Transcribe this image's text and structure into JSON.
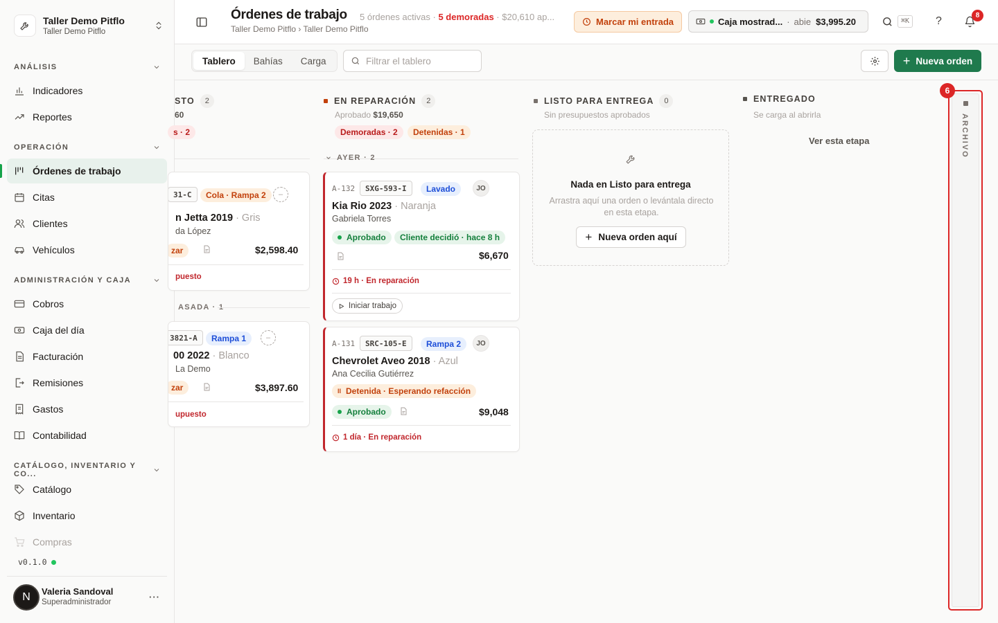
{
  "org": {
    "name": "Taller Demo Pitflo",
    "subtitle": "Taller Demo Pitflo"
  },
  "sidebar": {
    "sections": [
      {
        "label": "ANÁLISIS",
        "items": [
          {
            "label": "Indicadores",
            "icon": "chart-bars-icon"
          },
          {
            "label": "Reportes",
            "icon": "trend-up-icon"
          }
        ]
      },
      {
        "label": "OPERACIÓN",
        "items": [
          {
            "label": "Órdenes de trabajo",
            "icon": "kanban-icon",
            "active": true
          },
          {
            "label": "Citas",
            "icon": "calendar-icon"
          },
          {
            "label": "Clientes",
            "icon": "users-icon"
          },
          {
            "label": "Vehículos",
            "icon": "car-icon"
          }
        ]
      },
      {
        "label": "ADMINISTRACIÓN Y CAJA",
        "items": [
          {
            "label": "Cobros",
            "icon": "credit-card-icon"
          },
          {
            "label": "Caja del día",
            "icon": "cash-register-icon"
          },
          {
            "label": "Facturación",
            "icon": "invoice-icon"
          },
          {
            "label": "Remisiones",
            "icon": "file-export-icon"
          },
          {
            "label": "Gastos",
            "icon": "receipt-icon"
          },
          {
            "label": "Contabilidad",
            "icon": "book-icon"
          }
        ]
      },
      {
        "label": "CATÁLOGO, INVENTARIO Y CO...",
        "items": [
          {
            "label": "Catálogo",
            "icon": "tag-icon"
          },
          {
            "label": "Inventario",
            "icon": "box-icon"
          },
          {
            "label": "Compras",
            "icon": "cart-icon"
          }
        ]
      }
    ],
    "version": "v0.1.0"
  },
  "user": {
    "initial": "N",
    "name": "Valeria Sandoval",
    "role": "Superadministrador"
  },
  "header": {
    "title": "Órdenes de trabajo",
    "summary_active": "5 órdenes activas",
    "summary_sep": " · ",
    "summary_late": "5 demoradas",
    "summary_amount": "$20,610 ap...",
    "breadcrumb": "Taller Demo Pitflo › Taller Demo Pitflo",
    "entry_button": "Marcar mi entrada",
    "cash_label": "Caja mostrad...",
    "cash_status": "abie",
    "cash_amount": "$3,995.20",
    "shortcut": "⌘K",
    "notifications": "8"
  },
  "toolbar": {
    "tabs": [
      "Tablero",
      "Bahías",
      "Carga"
    ],
    "filter_placeholder": "Filtrar el tablero",
    "new_order": "Nueva orden"
  },
  "board": {
    "partial_column": {
      "title_fragment": "STO",
      "count": "2",
      "amount_fragment": "60",
      "badge_fragment": "s · 2",
      "card1": {
        "plate": "31-C",
        "bay": "Cola · Rampa 2",
        "car": "n Jetta 2019",
        "color": "Gris",
        "client": "da López",
        "status": "zar",
        "price": "$2,598.40",
        "footer": "puesto"
      },
      "group": "ASADA · 1",
      "card2": {
        "plate": "3821-A",
        "bay": "Rampa 1",
        "car": "00 2022",
        "color": "Blanco",
        "client": "La Demo",
        "status": "zar",
        "price": "$3,897.60",
        "footer": "upuesto"
      }
    },
    "repair": {
      "title": "EN REPARACIÓN",
      "count": "2",
      "approved_label": "Aprobado",
      "approved_amount": "$19,650",
      "late_badge": "Demoradas · 2",
      "held_badge": "Detenidas · 1",
      "group": "AYER · 2",
      "cards": [
        {
          "id": "A-132",
          "plate": "SXG-593-I",
          "tag": "Lavado",
          "initials": "JO",
          "car": "Kia Rio 2023",
          "color": "Naranja",
          "client": "Gabriela Torres",
          "status": "Aprobado",
          "decision": "Cliente decidió · hace 8 h",
          "price": "$6,670",
          "timer": "19 h · En reparación",
          "action": "Iniciar trabajo"
        },
        {
          "id": "A-131",
          "plate": "SRC-105-E",
          "tag": "Rampa 2",
          "initials": "JO",
          "car": "Chevrolet Aveo 2018",
          "color": "Azul",
          "client": "Ana Cecilia Gutiérrez",
          "hold": "Detenida · Esperando refacción",
          "status": "Aprobado",
          "price": "$9,048",
          "timer": "1 día · En reparación"
        }
      ]
    },
    "ready": {
      "title": "LISTO PARA ENTREGA",
      "count": "0",
      "subtitle": "Sin presupuestos aprobados",
      "empty_title": "Nada en Listo para entrega",
      "empty_desc": "Arrastra aquí una orden o levántala directo en esta etapa.",
      "empty_button": "Nueva orden aquí"
    },
    "delivered": {
      "title": "ENTREGADO",
      "subtitle": "Se carga al abrirla",
      "view_link": "Ver esta etapa"
    },
    "archive": {
      "label": "ARCHIVO",
      "badge": "6"
    }
  },
  "colors": {
    "accent": "#1f7a4d",
    "danger": "#dc2626",
    "warning": "#c2410c",
    "success": "#15803d",
    "info": "#1d4ed8"
  }
}
